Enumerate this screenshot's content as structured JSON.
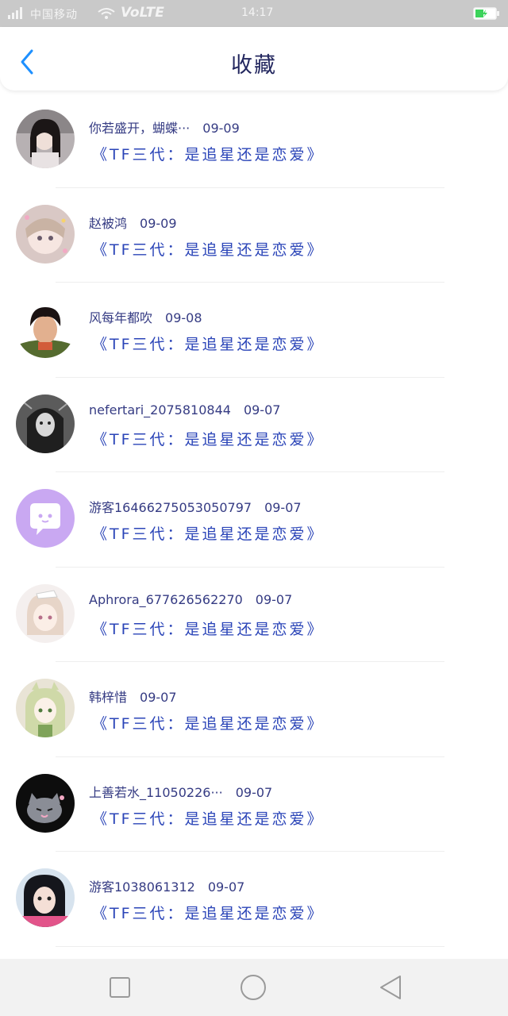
{
  "status_bar": {
    "carrier": "中国移动",
    "network": "VoLTE",
    "time": "14:17",
    "icons": [
      "signal-icon",
      "wifi-icon",
      "battery-charging-icon"
    ]
  },
  "header": {
    "title": "收藏",
    "back_icon": "chevron-left-icon"
  },
  "colors": {
    "accent": "#1e90ff",
    "subject_text": "#2b45b8",
    "meta_text": "#353b83",
    "status_bar_bg": "#c9c9c9",
    "battery_green": "#3cd35b"
  },
  "list": [
    {
      "name": "你若盛开，蝴蝶···",
      "date": "09-09",
      "subject": "《TF三代：是追星还是恋爱》"
    },
    {
      "name": "赵被鸿",
      "date": "09-09",
      "subject": "《TF三代：是追星还是恋爱》"
    },
    {
      "name": "风每年都吹",
      "date": "09-08",
      "subject": "《TF三代：是追星还是恋爱》"
    },
    {
      "name": "nefertari_2075810844",
      "date": "09-07",
      "subject": "《TF三代：是追星还是恋爱》"
    },
    {
      "name": "游客16466275053050797",
      "date": "09-07",
      "subject": "《TF三代：是追星还是恋爱》"
    },
    {
      "name": "Aphrora_677626562270",
      "date": "09-07",
      "subject": "《TF三代：是追星还是恋爱》"
    },
    {
      "name": "韩梓惜",
      "date": "09-07",
      "subject": "《TF三代：是追星还是恋爱》"
    },
    {
      "name": "上善若水_11050226···",
      "date": "09-07",
      "subject": "《TF三代：是追星还是恋爱》"
    },
    {
      "name": "游客1038061312",
      "date": "09-07",
      "subject": "《TF三代：是追星还是恋爱》"
    }
  ],
  "nav_bar": {
    "buttons": [
      "recent-apps-square-icon",
      "home-circle-icon",
      "back-triangle-icon"
    ]
  }
}
